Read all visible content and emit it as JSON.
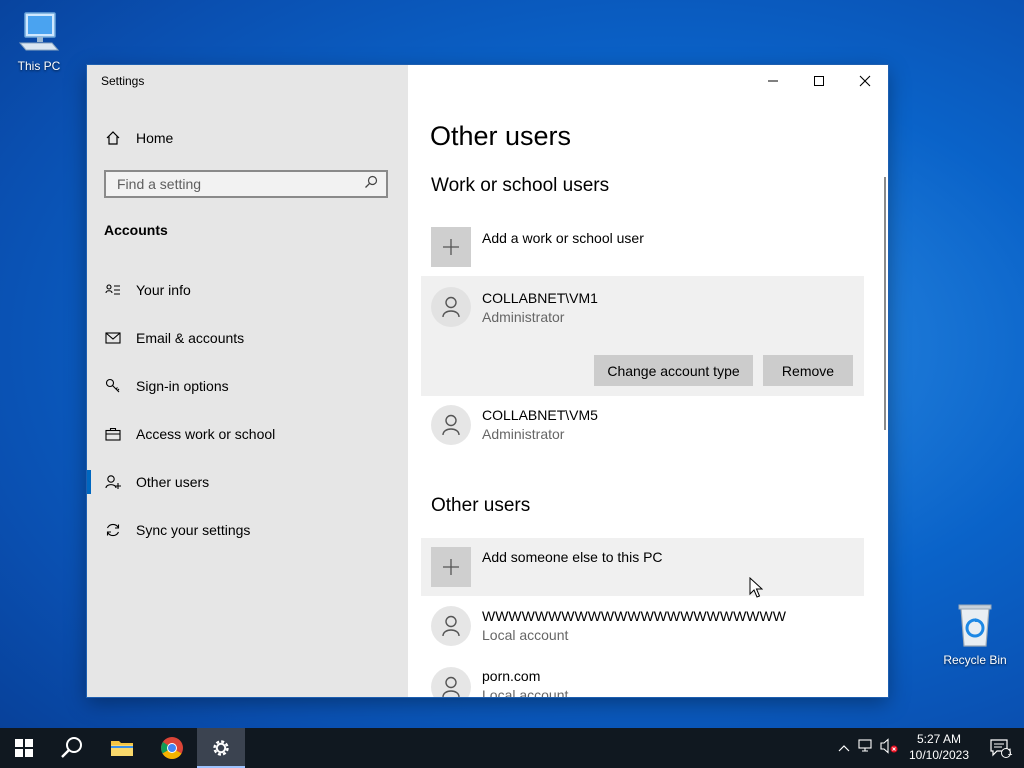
{
  "desktop": {
    "this_pc_label": "This PC",
    "recycle_bin_label": "Recycle Bin"
  },
  "window": {
    "title": "Settings",
    "controls": {
      "minimize": "minimize-icon",
      "maximize": "maximize-icon",
      "close": "close-icon"
    }
  },
  "sidebar": {
    "home_label": "Home",
    "search_placeholder": "Find a setting",
    "section_label": "Accounts",
    "items": [
      {
        "label": "Your info",
        "icon": "contact-card-icon"
      },
      {
        "label": "Email & accounts",
        "icon": "mail-icon"
      },
      {
        "label": "Sign-in options",
        "icon": "key-icon"
      },
      {
        "label": "Access work or school",
        "icon": "briefcase-icon"
      },
      {
        "label": "Other users",
        "icon": "add-person-icon",
        "selected": true
      },
      {
        "label": "Sync your settings",
        "icon": "sync-icon"
      }
    ]
  },
  "content": {
    "page_title": "Other users",
    "work_section_title": "Work or school users",
    "add_work_user_label": "Add a work or school user",
    "work_users": [
      {
        "name": "COLLABNET\\VM1",
        "role": "Administrator",
        "expanded": true
      },
      {
        "name": "COLLABNET\\VM5",
        "role": "Administrator"
      }
    ],
    "change_account_type_label": "Change account type",
    "remove_label": "Remove",
    "other_section_title": "Other users",
    "add_someone_label": "Add someone else to this PC",
    "other_users": [
      {
        "name": "WWWWWWWWWWWWWWWWWWWWWWW",
        "role": "Local account"
      },
      {
        "name": "porn.com",
        "role": "Local account"
      }
    ]
  },
  "taskbar": {
    "time": "5:27 AM",
    "date": "10/10/2023",
    "notification_count": "1"
  },
  "colors": {
    "accent": "#0067c0",
    "taskbar": "#101820",
    "sidebar": "#e6e6e6"
  }
}
